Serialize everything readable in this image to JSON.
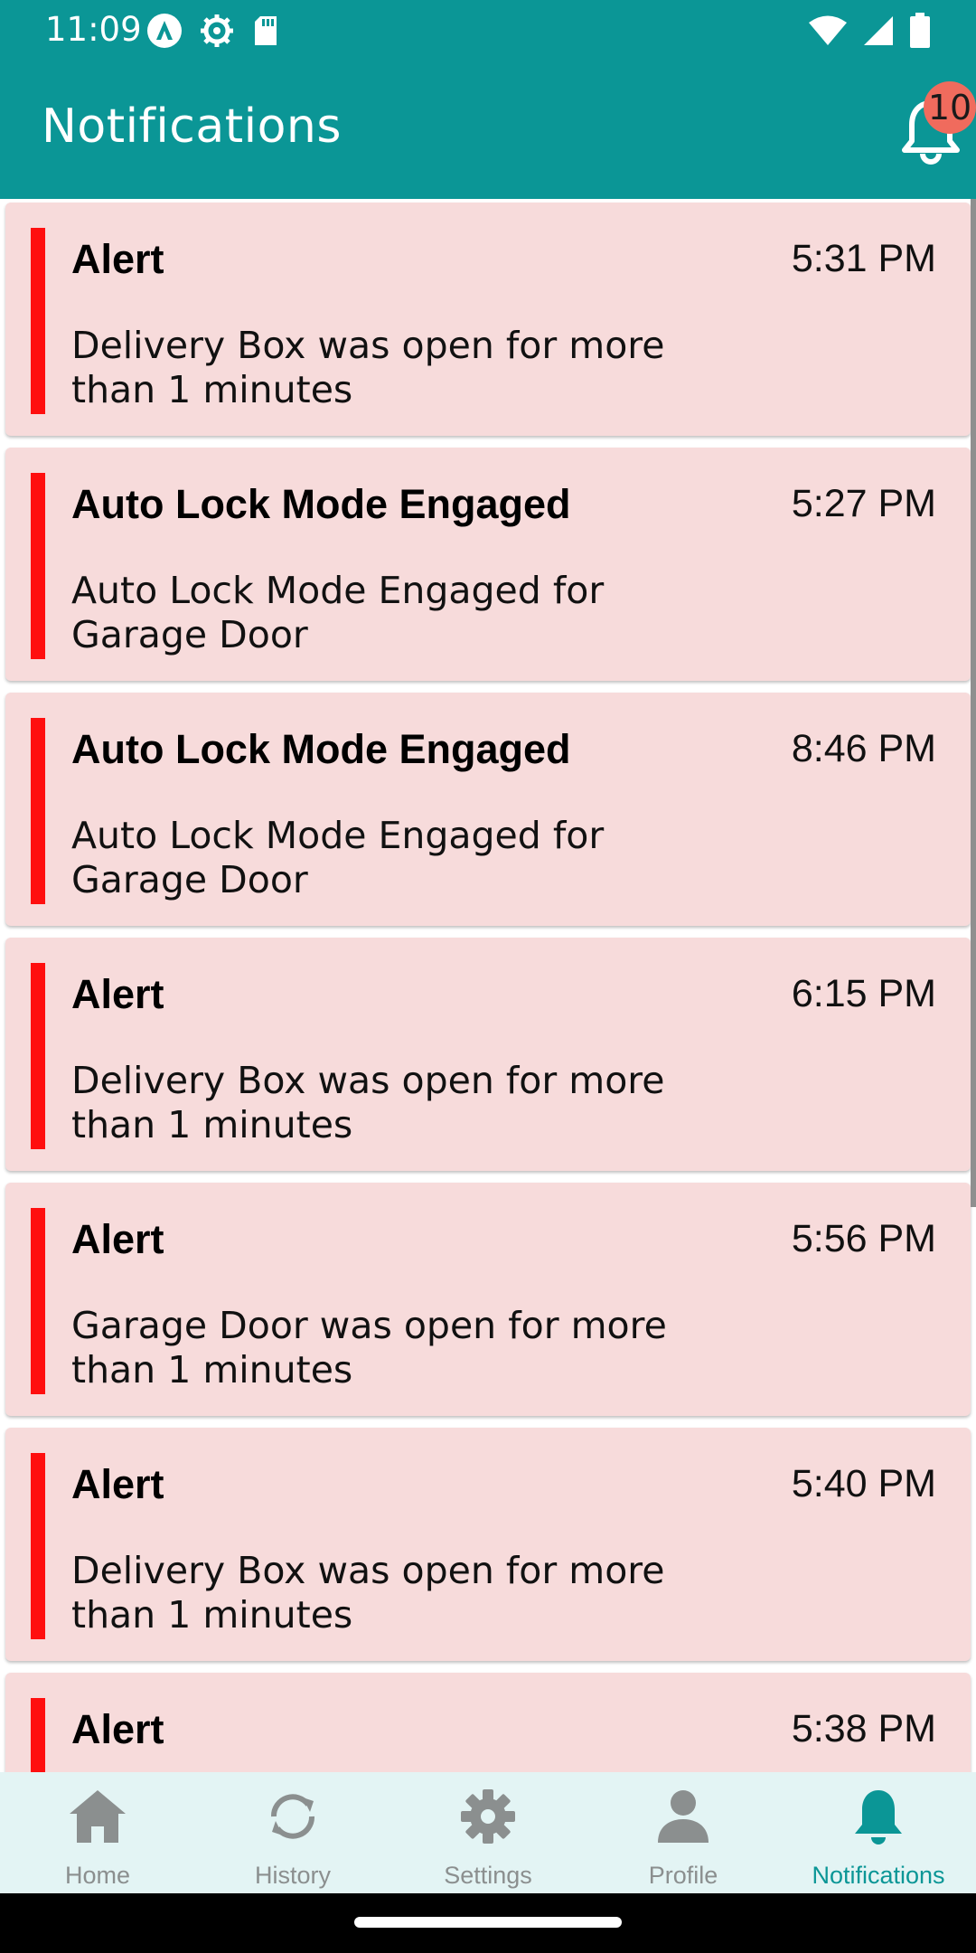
{
  "status_bar": {
    "time": "11:09",
    "left_icons": [
      "android-auto-icon",
      "settings-gear-icon",
      "sd-card-icon"
    ],
    "right_icons": [
      "wifi-icon",
      "cellular-signal-icon",
      "battery-icon"
    ]
  },
  "app_bar": {
    "title": "Notifications",
    "bell_icon": "bell-outline-icon",
    "badge_count": "10",
    "background_color": "#0b9696",
    "badge_color": "#f06b5d"
  },
  "notifications": [
    {
      "title": "Alert",
      "time": "5:31 PM",
      "message": "Delivery Box was open for more than 1 minutes"
    },
    {
      "title": "Auto Lock Mode Engaged",
      "time": "5:27 PM",
      "message": "Auto Lock Mode Engaged for Garage Door"
    },
    {
      "title": "Auto Lock Mode Engaged",
      "time": "8:46 PM",
      "message": "Auto Lock Mode Engaged for Garage Door"
    },
    {
      "title": "Alert",
      "time": "6:15 PM",
      "message": "Delivery Box was open for more than 1 minutes"
    },
    {
      "title": "Alert",
      "time": "5:56 PM",
      "message": "Garage Door was open for more than 1 minutes"
    },
    {
      "title": "Alert",
      "time": "5:40 PM",
      "message": "Delivery Box was open for more than 1 minutes"
    },
    {
      "title": "Alert",
      "time": "5:38 PM",
      "message": ""
    }
  ],
  "card_colors": {
    "background": "#f7dbdb",
    "accent": "#ff0f0f"
  },
  "bottom_nav": {
    "items": [
      {
        "label": "Home",
        "icon": "home-icon"
      },
      {
        "label": "History",
        "icon": "sync-icon"
      },
      {
        "label": "Settings",
        "icon": "gear-icon"
      },
      {
        "label": "Profile",
        "icon": "person-icon"
      },
      {
        "label": "Notifications",
        "icon": "bell-icon"
      }
    ],
    "active": "Notifications",
    "active_color": "#0b9696",
    "inactive_color": "#8b8f8f"
  }
}
